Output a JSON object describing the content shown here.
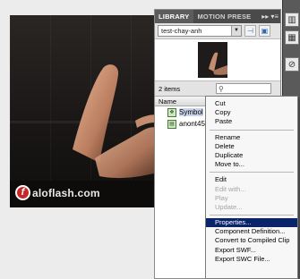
{
  "stage": {
    "watermark_text": "aloflash.com",
    "watermark_icon": "flash-logo-icon"
  },
  "library": {
    "tabs": [
      "LIBRARY",
      "MOTION PRESE"
    ],
    "tab_controls": [
      "▸▸",
      "▾≡"
    ],
    "document": "test-chay-anh",
    "item_count": "2 items",
    "column_header": "Name",
    "items": [
      {
        "name": "Symbol",
        "icon": "movie-clip-icon"
      },
      {
        "name": "anont45",
        "icon": "bitmap-icon"
      }
    ]
  },
  "context_menu": {
    "groups": [
      [
        {
          "label": "Cut",
          "enabled": true
        },
        {
          "label": "Copy",
          "enabled": true
        },
        {
          "label": "Paste",
          "enabled": true
        }
      ],
      [
        {
          "label": "Rename",
          "enabled": true
        },
        {
          "label": "Delete",
          "enabled": true
        },
        {
          "label": "Duplicate",
          "enabled": true
        },
        {
          "label": "Move to...",
          "enabled": true
        }
      ],
      [
        {
          "label": "Edit",
          "enabled": true
        },
        {
          "label": "Edit with...",
          "enabled": false
        },
        {
          "label": "Play",
          "enabled": false
        },
        {
          "label": "Update...",
          "enabled": false
        }
      ],
      [
        {
          "label": "Properties...",
          "enabled": true,
          "highlighted": true
        },
        {
          "label": "Component Definition...",
          "enabled": true
        },
        {
          "label": "Convert to Compiled Clip",
          "enabled": true
        },
        {
          "label": "Export SWF...",
          "enabled": true
        },
        {
          "label": "Export SWC File...",
          "enabled": true
        }
      ]
    ]
  },
  "colors": {
    "highlight": "#0a246a",
    "panel_tabbar": "#4a4a4a",
    "watermark_red": "#c62828"
  }
}
